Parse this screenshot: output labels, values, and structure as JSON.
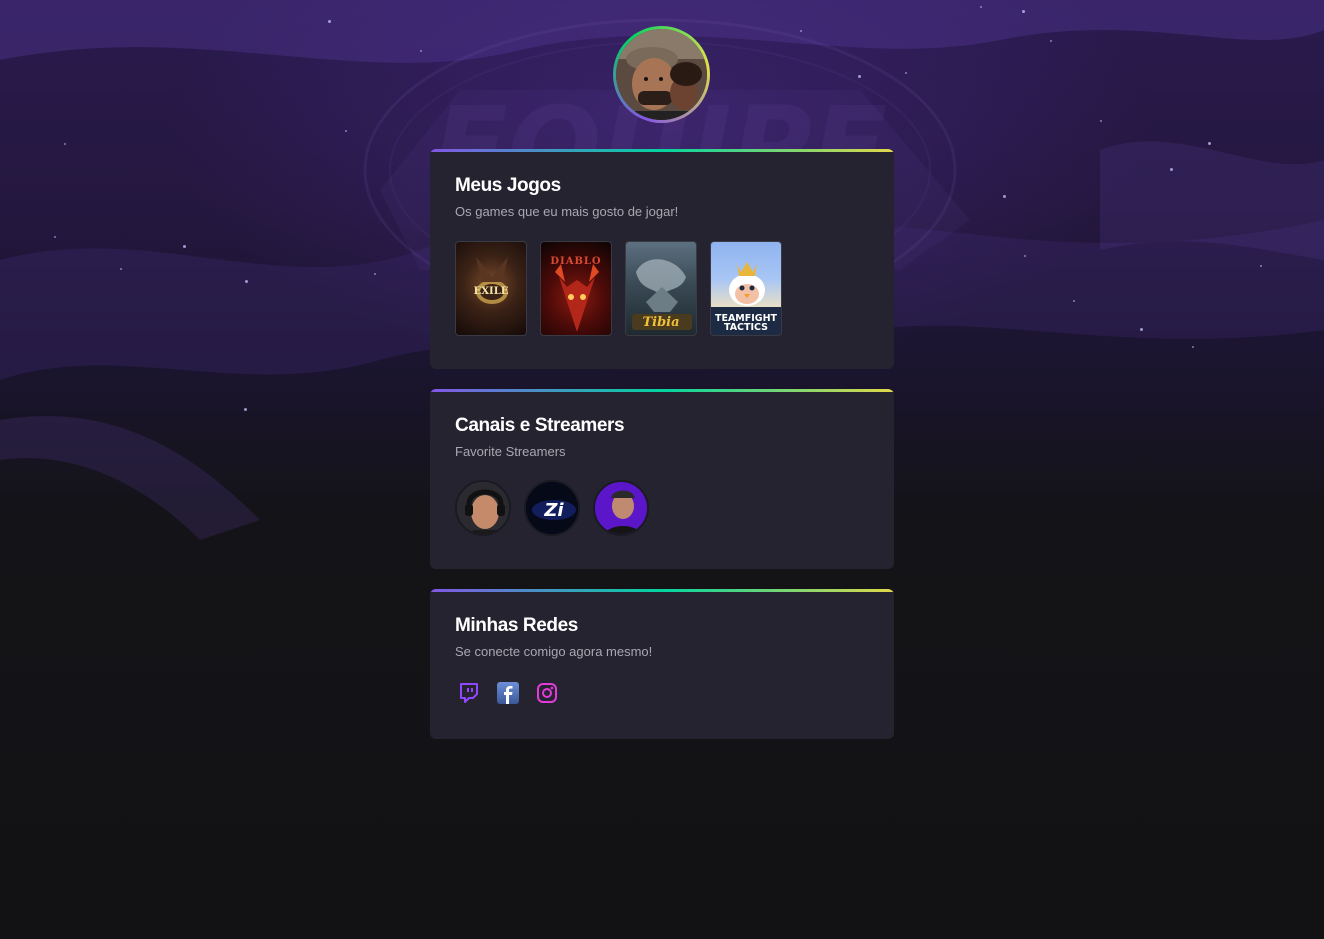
{
  "profile": {
    "avatar_alt": "profile-photo"
  },
  "games_card": {
    "title": "Meus Jogos",
    "subtitle": "Os games que eu mais gosto de jogar!",
    "games": [
      {
        "name": "path-of-exile",
        "label": "EXILE"
      },
      {
        "name": "diablo",
        "label": "DIABLO"
      },
      {
        "name": "tibia",
        "label": "Tibia"
      },
      {
        "name": "teamfight-tactics",
        "label": "TEAMFIGHT TACTICS"
      }
    ]
  },
  "streamers_card": {
    "title": "Canais e Streamers",
    "subtitle": "Favorite Streamers",
    "streamers": [
      {
        "name": "streamer-1"
      },
      {
        "name": "streamer-2",
        "label": "Zi"
      },
      {
        "name": "streamer-3"
      }
    ]
  },
  "social_card": {
    "title": "Minhas Redes",
    "subtitle": "Se conecte comigo agora mesmo!",
    "links": [
      {
        "name": "twitch-icon",
        "color": "#9147ff"
      },
      {
        "name": "facebook-icon",
        "color": "#4267b2"
      },
      {
        "name": "instagram-icon",
        "color": "#e33bd9"
      }
    ]
  },
  "colors": {
    "accent_start": "#8257e5",
    "accent_mid": "#04d3a0",
    "accent_end": "#e1d84a",
    "card_bg": "#25232f",
    "page_bg": "#121214"
  }
}
